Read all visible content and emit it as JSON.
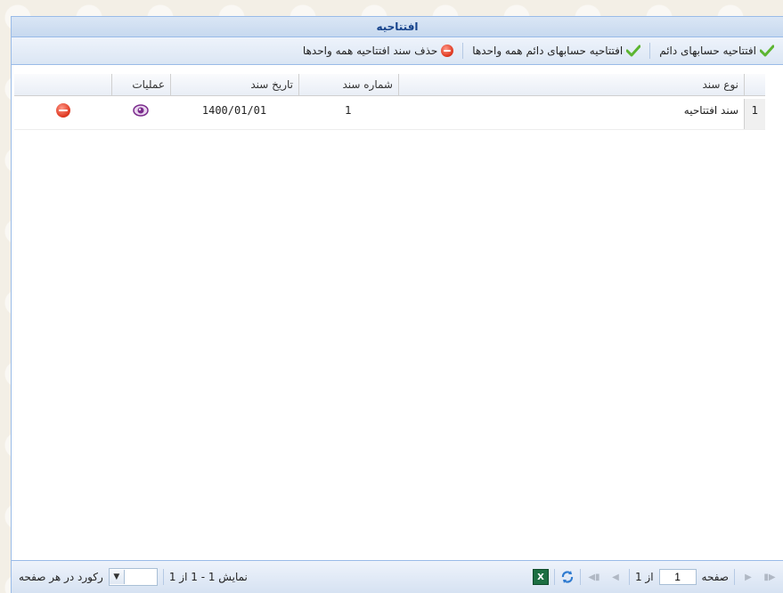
{
  "window": {
    "title": "افتتاحیه"
  },
  "toolbar": {
    "btn_open_permanent": "افتتاحیه حسابهای دائم",
    "btn_open_permanent_all": "افتتاحیه حسابهای دائم همه واحدها",
    "btn_delete_all": "حذف سند افتتاحیه همه واحدها"
  },
  "grid": {
    "columns": {
      "doc_type": "نوع سند",
      "doc_number": "شماره سند",
      "doc_date": "تاریخ سند",
      "operations": "عملیات"
    },
    "rows": [
      {
        "index": "1",
        "doc_type": "سند افتتاحیه",
        "doc_number": "1",
        "doc_date": "1400/01/01"
      }
    ]
  },
  "pager": {
    "page_label": "صفحه",
    "page_value": "1",
    "of_total": "از 1",
    "display_info": "نمایش 1 - 1 از 1",
    "records_per_page": "رکورد در هر صفحه",
    "excel_glyph": "X"
  },
  "colors": {
    "accent": "#15428b",
    "border": "#99bbe8",
    "delete": "#e03a22",
    "check": "#5cb531"
  }
}
